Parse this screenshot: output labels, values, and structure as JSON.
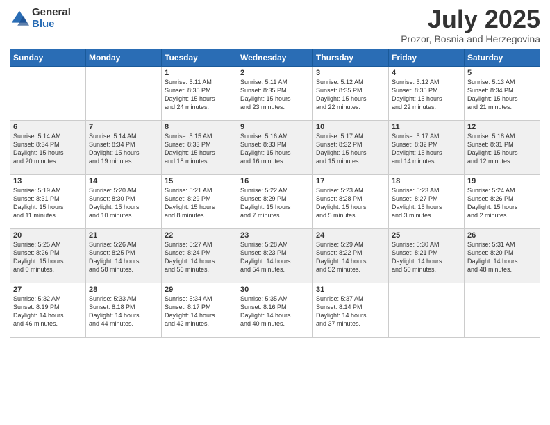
{
  "header": {
    "logo_general": "General",
    "logo_blue": "Blue",
    "month_title": "July 2025",
    "location": "Prozor, Bosnia and Herzegovina"
  },
  "days_of_week": [
    "Sunday",
    "Monday",
    "Tuesday",
    "Wednesday",
    "Thursday",
    "Friday",
    "Saturday"
  ],
  "weeks": [
    [
      {
        "day": "",
        "detail": ""
      },
      {
        "day": "",
        "detail": ""
      },
      {
        "day": "1",
        "detail": "Sunrise: 5:11 AM\nSunset: 8:35 PM\nDaylight: 15 hours\nand 24 minutes."
      },
      {
        "day": "2",
        "detail": "Sunrise: 5:11 AM\nSunset: 8:35 PM\nDaylight: 15 hours\nand 23 minutes."
      },
      {
        "day": "3",
        "detail": "Sunrise: 5:12 AM\nSunset: 8:35 PM\nDaylight: 15 hours\nand 22 minutes."
      },
      {
        "day": "4",
        "detail": "Sunrise: 5:12 AM\nSunset: 8:35 PM\nDaylight: 15 hours\nand 22 minutes."
      },
      {
        "day": "5",
        "detail": "Sunrise: 5:13 AM\nSunset: 8:34 PM\nDaylight: 15 hours\nand 21 minutes."
      }
    ],
    [
      {
        "day": "6",
        "detail": "Sunrise: 5:14 AM\nSunset: 8:34 PM\nDaylight: 15 hours\nand 20 minutes."
      },
      {
        "day": "7",
        "detail": "Sunrise: 5:14 AM\nSunset: 8:34 PM\nDaylight: 15 hours\nand 19 minutes."
      },
      {
        "day": "8",
        "detail": "Sunrise: 5:15 AM\nSunset: 8:33 PM\nDaylight: 15 hours\nand 18 minutes."
      },
      {
        "day": "9",
        "detail": "Sunrise: 5:16 AM\nSunset: 8:33 PM\nDaylight: 15 hours\nand 16 minutes."
      },
      {
        "day": "10",
        "detail": "Sunrise: 5:17 AM\nSunset: 8:32 PM\nDaylight: 15 hours\nand 15 minutes."
      },
      {
        "day": "11",
        "detail": "Sunrise: 5:17 AM\nSunset: 8:32 PM\nDaylight: 15 hours\nand 14 minutes."
      },
      {
        "day": "12",
        "detail": "Sunrise: 5:18 AM\nSunset: 8:31 PM\nDaylight: 15 hours\nand 12 minutes."
      }
    ],
    [
      {
        "day": "13",
        "detail": "Sunrise: 5:19 AM\nSunset: 8:31 PM\nDaylight: 15 hours\nand 11 minutes."
      },
      {
        "day": "14",
        "detail": "Sunrise: 5:20 AM\nSunset: 8:30 PM\nDaylight: 15 hours\nand 10 minutes."
      },
      {
        "day": "15",
        "detail": "Sunrise: 5:21 AM\nSunset: 8:29 PM\nDaylight: 15 hours\nand 8 minutes."
      },
      {
        "day": "16",
        "detail": "Sunrise: 5:22 AM\nSunset: 8:29 PM\nDaylight: 15 hours\nand 7 minutes."
      },
      {
        "day": "17",
        "detail": "Sunrise: 5:23 AM\nSunset: 8:28 PM\nDaylight: 15 hours\nand 5 minutes."
      },
      {
        "day": "18",
        "detail": "Sunrise: 5:23 AM\nSunset: 8:27 PM\nDaylight: 15 hours\nand 3 minutes."
      },
      {
        "day": "19",
        "detail": "Sunrise: 5:24 AM\nSunset: 8:26 PM\nDaylight: 15 hours\nand 2 minutes."
      }
    ],
    [
      {
        "day": "20",
        "detail": "Sunrise: 5:25 AM\nSunset: 8:26 PM\nDaylight: 15 hours\nand 0 minutes."
      },
      {
        "day": "21",
        "detail": "Sunrise: 5:26 AM\nSunset: 8:25 PM\nDaylight: 14 hours\nand 58 minutes."
      },
      {
        "day": "22",
        "detail": "Sunrise: 5:27 AM\nSunset: 8:24 PM\nDaylight: 14 hours\nand 56 minutes."
      },
      {
        "day": "23",
        "detail": "Sunrise: 5:28 AM\nSunset: 8:23 PM\nDaylight: 14 hours\nand 54 minutes."
      },
      {
        "day": "24",
        "detail": "Sunrise: 5:29 AM\nSunset: 8:22 PM\nDaylight: 14 hours\nand 52 minutes."
      },
      {
        "day": "25",
        "detail": "Sunrise: 5:30 AM\nSunset: 8:21 PM\nDaylight: 14 hours\nand 50 minutes."
      },
      {
        "day": "26",
        "detail": "Sunrise: 5:31 AM\nSunset: 8:20 PM\nDaylight: 14 hours\nand 48 minutes."
      }
    ],
    [
      {
        "day": "27",
        "detail": "Sunrise: 5:32 AM\nSunset: 8:19 PM\nDaylight: 14 hours\nand 46 minutes."
      },
      {
        "day": "28",
        "detail": "Sunrise: 5:33 AM\nSunset: 8:18 PM\nDaylight: 14 hours\nand 44 minutes."
      },
      {
        "day": "29",
        "detail": "Sunrise: 5:34 AM\nSunset: 8:17 PM\nDaylight: 14 hours\nand 42 minutes."
      },
      {
        "day": "30",
        "detail": "Sunrise: 5:35 AM\nSunset: 8:16 PM\nDaylight: 14 hours\nand 40 minutes."
      },
      {
        "day": "31",
        "detail": "Sunrise: 5:37 AM\nSunset: 8:14 PM\nDaylight: 14 hours\nand 37 minutes."
      },
      {
        "day": "",
        "detail": ""
      },
      {
        "day": "",
        "detail": ""
      }
    ]
  ]
}
